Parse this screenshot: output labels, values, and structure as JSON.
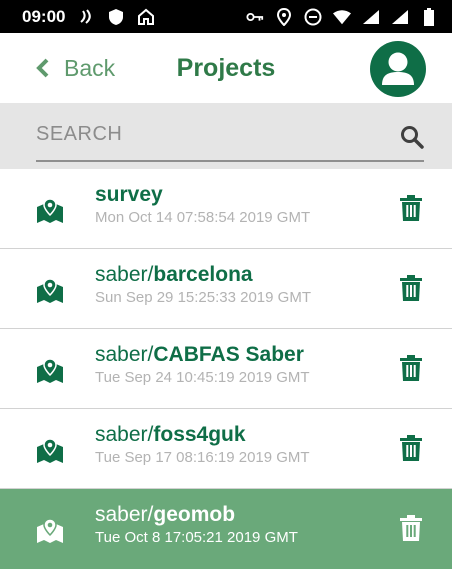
{
  "status_bar": {
    "time": "09:00"
  },
  "header": {
    "back_label": "Back",
    "title": "Projects"
  },
  "search": {
    "placeholder": "SEARCH"
  },
  "colors": {
    "brand_dark": "#0f6e47",
    "brand_light": "#5f9a6d",
    "selected_row": "#6aa97a"
  },
  "projects": [
    {
      "prefix": "",
      "name": "survey",
      "date": "Mon Oct 14 07:58:54 2019 GMT",
      "selected": false
    },
    {
      "prefix": "saber/",
      "name": "barcelona",
      "date": "Sun Sep 29 15:25:33 2019 GMT",
      "selected": false
    },
    {
      "prefix": "saber/",
      "name": "CABFAS Saber",
      "date": "Tue Sep 24 10:45:19 2019 GMT",
      "selected": false
    },
    {
      "prefix": "saber/",
      "name": "foss4guk",
      "date": "Tue Sep 17 08:16:19 2019 GMT",
      "selected": false
    },
    {
      "prefix": "saber/",
      "name": "geomob",
      "date": "Tue Oct 8 17:05:21 2019 GMT",
      "selected": true
    }
  ]
}
